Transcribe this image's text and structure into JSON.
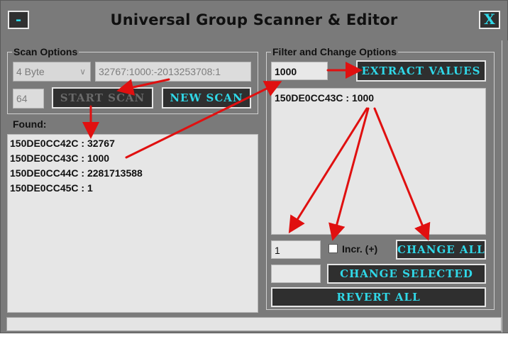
{
  "window": {
    "title": "Universal Group Scanner & Editor",
    "minimize_label": "-",
    "close_label": "X"
  },
  "scan_options": {
    "label": "Scan Options",
    "type_value": "4 Byte",
    "scan_string": "32767:1000:-2013253708:1",
    "count_value": "64",
    "start_scan_label": "START SCAN",
    "new_scan_label": "NEW SCAN"
  },
  "found": {
    "label": "Found:",
    "items": [
      "150DE0CC42C : 32767",
      "150DE0CC43C : 1000",
      "150DE0CC44C : 2281713588",
      "150DE0CC45C : 1"
    ]
  },
  "filter": {
    "label": "Filter and Change Options",
    "filter_value": "1000",
    "extract_label": "EXTRACT VALUES",
    "results": [
      "150DE0CC43C : 1000"
    ],
    "change_value": "1",
    "incr_label": "Incr. (+)",
    "change_all_label": "CHANGE ALL",
    "change_selected_value": "",
    "change_selected_label": "CHANGE SELECTED",
    "revert_all_label": "REVERT ALL"
  },
  "colors": {
    "accent_text": "#30d8e8",
    "button_bg": "#2f2f2f",
    "window_bg": "#7a7a7a",
    "annotation_arrow": "#e01010"
  }
}
